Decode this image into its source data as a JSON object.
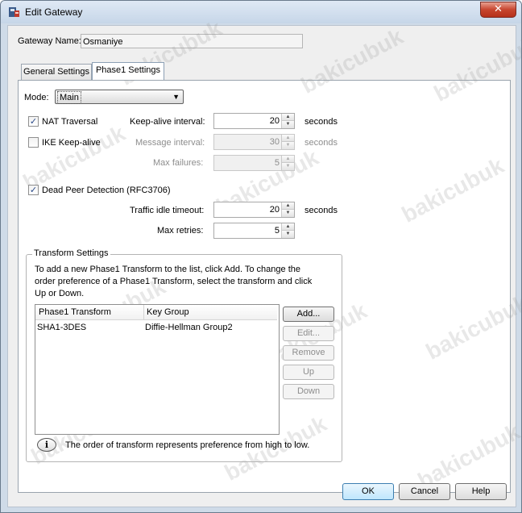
{
  "window": {
    "title": "Edit Gateway",
    "close_label": "✕"
  },
  "gateway_name": {
    "label": "Gateway Name:",
    "value": "Osmaniye"
  },
  "tabs": [
    {
      "label": "General Settings"
    },
    {
      "label": "Phase1 Settings"
    }
  ],
  "mode": {
    "label": "Mode:",
    "value": "Main"
  },
  "nat": {
    "label": "NAT Traversal",
    "checked_mark": "✓",
    "keepalive_label": "Keep-alive interval:",
    "keepalive_value": "20",
    "keepalive_unit": "seconds"
  },
  "ike": {
    "label": "IKE Keep-alive",
    "message_label": "Message interval:",
    "message_value": "30",
    "message_unit": "seconds",
    "maxfail_label": "Max failures:",
    "maxfail_value": "5"
  },
  "dpd": {
    "label": "Dead Peer Detection (RFC3706)",
    "checked_mark": "✓",
    "idle_label": "Traffic idle timeout:",
    "idle_value": "20",
    "idle_unit": "seconds",
    "retries_label": "Max retries:",
    "retries_value": "5"
  },
  "transform": {
    "group_title": "Transform Settings",
    "description_lines": [
      "To add a new Phase1 Transform to the list, click Add. To change the",
      "order preference of a Phase1 Transform, select the transform and click",
      "Up or Down."
    ],
    "columns": [
      "Phase1 Transform",
      "Key Group"
    ],
    "rows": [
      {
        "transform": "SHA1-3DES",
        "key_group": "Diffie-Hellman Group2"
      }
    ],
    "buttons": {
      "add": "Add...",
      "edit": "Edit...",
      "remove": "Remove",
      "up": "Up",
      "down": "Down"
    },
    "info_icon": "i",
    "info_text": "The order of transform represents preference from high to low."
  },
  "footer": {
    "ok": "OK",
    "cancel": "Cancel",
    "help": "Help"
  },
  "watermark": "bakicubuk",
  "colors": {
    "title_bar": "#c6d6e8",
    "close": "#c7452e",
    "ok_highlight": "#bee6fd"
  }
}
